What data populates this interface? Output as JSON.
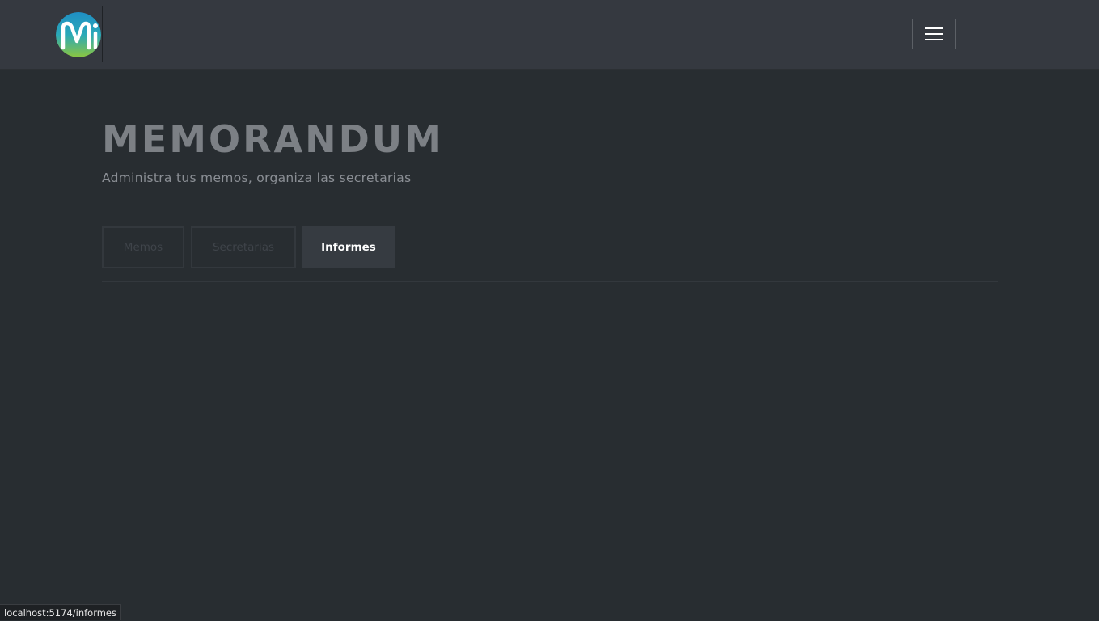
{
  "app": {
    "logo_text": "Mi"
  },
  "hero": {
    "title": "MEMORANDUM",
    "subtitle": "Administra tus memos, organiza las secretarias"
  },
  "tabs": [
    {
      "label": "Memos",
      "active": false
    },
    {
      "label": "Secretarias",
      "active": false
    },
    {
      "label": "Informes",
      "active": true
    }
  ],
  "status_bar": {
    "url": "localhost:5174/informes"
  },
  "icons": {
    "menu": "hamburger-menu-icon",
    "logo": "mi-logo-icon"
  },
  "colors": {
    "page_background": "#282d31",
    "navbar_background": "#353940",
    "active_tab_background": "#363b41"
  }
}
